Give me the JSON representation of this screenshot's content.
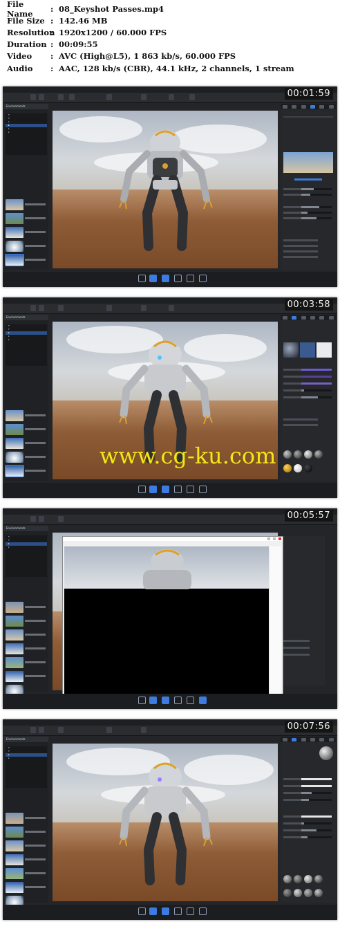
{
  "media_info": [
    {
      "key": "File Name",
      "value": "08_Keyshot Passes.mp4"
    },
    {
      "key": "File Size",
      "value": "142.46 MB"
    },
    {
      "key": "Resolution",
      "value": "1920x1200 / 60.000 FPS"
    },
    {
      "key": "Duration",
      "value": "00:09:55"
    },
    {
      "key": "Video",
      "value": "AVC (High@L5), 1 863 kb/s, 60.000 FPS"
    },
    {
      "key": "Audio",
      "value": "AAC, 128 kb/s (CBR), 44.1 kHz, 2 channels, 1 stream"
    }
  ],
  "colon": ":",
  "watermark": "www.cg-ku.com",
  "frames": [
    {
      "timestamp": "00:01:59",
      "right_panel": "Environment",
      "library_panel": "Environments"
    },
    {
      "timestamp": "00:03:58",
      "right_panel": "Material",
      "library_panel": "Environments"
    },
    {
      "timestamp": "00:05:57",
      "right_panel": "Camera",
      "library_panel": "Environments"
    },
    {
      "timestamp": "00:07:56",
      "right_panel": "Material",
      "library_panel": "Environments"
    }
  ],
  "colors": {
    "app_bg": "#232528",
    "accent": "#3d7be0",
    "watermark": "#f7e51a",
    "timestamp_bg": "#141414"
  },
  "icons": [
    "import-icon",
    "library-icon",
    "project-icon",
    "animation-icon",
    "keyshotxr-icon",
    "render-icon"
  ]
}
